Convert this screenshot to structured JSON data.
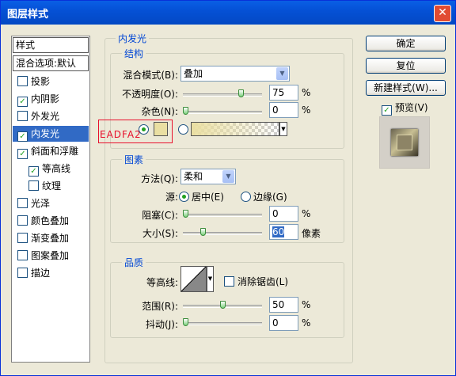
{
  "window": {
    "title": "图层样式",
    "close_icon": "close-icon"
  },
  "styles_list": {
    "header": "样式",
    "blend_options": "混合选项:默认",
    "items": [
      {
        "label": "投影",
        "checked": false,
        "selected": false,
        "indent": false
      },
      {
        "label": "内阴影",
        "checked": true,
        "selected": false,
        "indent": false
      },
      {
        "label": "外发光",
        "checked": false,
        "selected": false,
        "indent": false
      },
      {
        "label": "内发光",
        "checked": true,
        "selected": true,
        "indent": false
      },
      {
        "label": "斜面和浮雕",
        "checked": true,
        "selected": false,
        "indent": false
      },
      {
        "label": "等高线",
        "checked": true,
        "selected": false,
        "indent": true
      },
      {
        "label": "纹理",
        "checked": false,
        "selected": false,
        "indent": true
      },
      {
        "label": "光泽",
        "checked": false,
        "selected": false,
        "indent": false
      },
      {
        "label": "颜色叠加",
        "checked": false,
        "selected": false,
        "indent": false
      },
      {
        "label": "渐变叠加",
        "checked": false,
        "selected": false,
        "indent": false
      },
      {
        "label": "图案叠加",
        "checked": false,
        "selected": false,
        "indent": false
      },
      {
        "label": "描边",
        "checked": false,
        "selected": false,
        "indent": false
      }
    ]
  },
  "inner_glow": {
    "title": "内发光",
    "structure": {
      "title": "结构",
      "blend_mode_label": "混合模式(B):",
      "blend_mode_value": "叠加",
      "opacity_label": "不透明度(O):",
      "opacity_value": "75",
      "opacity_fraction": 0.75,
      "noise_label": "杂色(N):",
      "noise_value": "0",
      "noise_fraction": 0,
      "percent": "%",
      "color_hex_annotation": "EADFA2",
      "glow_color": "#eadfa2",
      "color_mode": "solid"
    },
    "elements": {
      "title": "图素",
      "technique_label": "方法(Q):",
      "technique_value": "柔和",
      "source_label": "源:",
      "source_center": "居中(E)",
      "source_edge": "边缘(G)",
      "source_selected": "center",
      "choke_label": "阻塞(C):",
      "choke_value": "0",
      "choke_fraction": 0,
      "size_label": "大小(S):",
      "size_value": "60",
      "size_fraction": 0.24,
      "percent": "%",
      "px_unit": "像素"
    },
    "quality": {
      "title": "品质",
      "contour_label": "等高线:",
      "anti_alias_label": "消除锯齿(L)",
      "anti_alias_checked": false,
      "range_label": "范围(R):",
      "range_value": "50",
      "range_fraction": 0.5,
      "jitter_label": "抖动(J):",
      "jitter_value": "0",
      "jitter_fraction": 0,
      "percent": "%"
    }
  },
  "buttons": {
    "ok": "确定",
    "reset": "复位",
    "new_style": "新建样式(W)...",
    "preview_label": "预览(V)",
    "preview_checked": true
  },
  "colors": {
    "accent": "#316ac5",
    "group_label": "#0046d5",
    "annotation": "#e8102c",
    "title_bar": "#0551d6"
  }
}
